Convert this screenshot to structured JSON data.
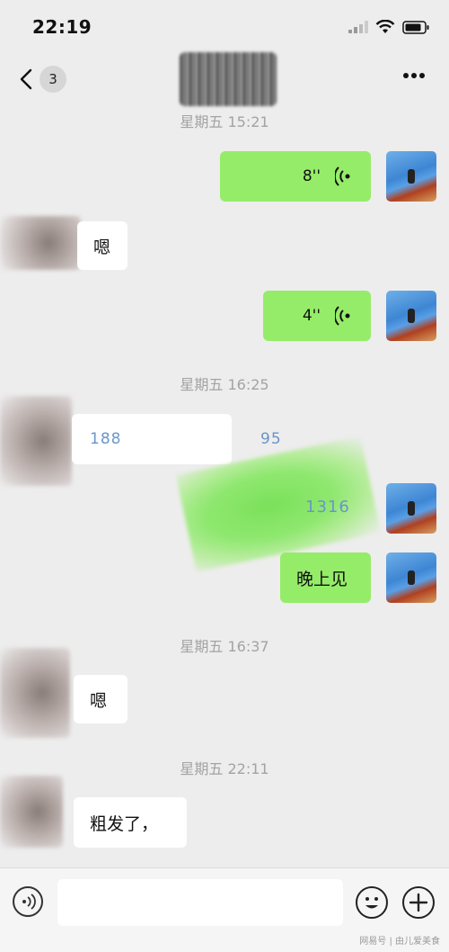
{
  "status_bar": {
    "time": "22:19",
    "icons": [
      "signal-icon",
      "wifi-icon",
      "battery-icon"
    ]
  },
  "nav": {
    "back_icon": "chevron-left-icon",
    "unread_count": "3",
    "more_icon": "more-horizontal-icon"
  },
  "messages": [
    {
      "type": "time",
      "text": "星期五 15:21"
    },
    {
      "type": "voice",
      "side": "self",
      "duration": "8''"
    },
    {
      "type": "text",
      "side": "other",
      "text": "嗯"
    },
    {
      "type": "voice",
      "side": "self",
      "duration": "4''"
    },
    {
      "type": "time",
      "text": "星期五 16:25"
    },
    {
      "type": "text",
      "side": "other",
      "text_parts": [
        "188",
        "95"
      ]
    },
    {
      "type": "text",
      "side": "self",
      "text": "1316"
    },
    {
      "type": "text",
      "side": "self",
      "text": "晚上见"
    },
    {
      "type": "time",
      "text": "星期五 16:37"
    },
    {
      "type": "text",
      "side": "other",
      "text": "嗯"
    },
    {
      "type": "time",
      "text": "星期五 22:11"
    },
    {
      "type": "text",
      "side": "other",
      "text": "粗发了，"
    }
  ],
  "input_bar": {
    "voice_icon": "voice-input-icon",
    "emoji_icon": "emoji-icon",
    "plus_icon": "plus-icon"
  },
  "watermark": "网易号 | 由儿爱美食",
  "colors": {
    "self_bubble": "#95ec69",
    "other_bubble": "#ffffff",
    "background": "#ededed",
    "time_label": "#a3a3a3"
  }
}
